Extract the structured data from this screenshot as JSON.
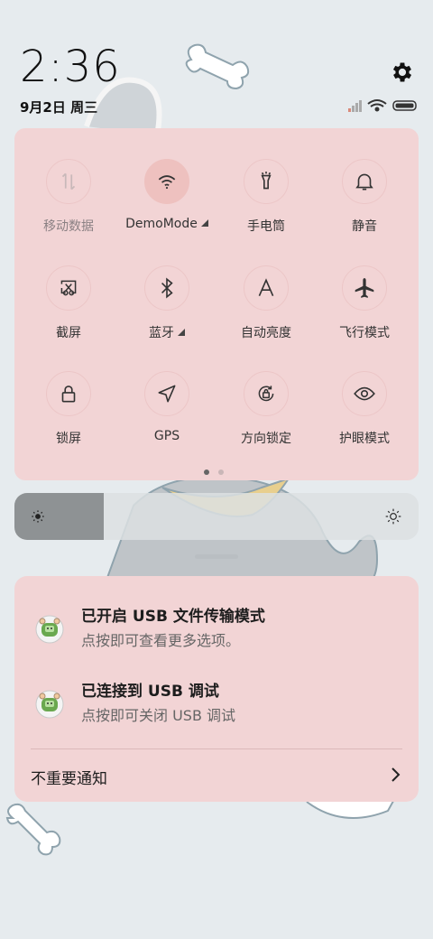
{
  "status_bar": {
    "time": "2:36",
    "date": "9月2日 周三",
    "settings_icon": "gear-icon",
    "signal_icon": "signal-icon",
    "wifi_icon": "wifi-icon",
    "battery_icon": "battery-icon"
  },
  "quick_settings": {
    "tiles": [
      {
        "label": "移动数据",
        "icon": "mobile-data-icon",
        "active": false,
        "disabled": true
      },
      {
        "label": "DemoMode",
        "icon": "wifi-icon",
        "active": true,
        "expandable": true
      },
      {
        "label": "手电筒",
        "icon": "flashlight-icon",
        "active": false
      },
      {
        "label": "静音",
        "icon": "bell-icon",
        "active": false
      },
      {
        "label": "截屏",
        "icon": "screenshot-icon",
        "active": false
      },
      {
        "label": "蓝牙",
        "icon": "bluetooth-icon",
        "active": false,
        "expandable": true
      },
      {
        "label": "自动亮度",
        "icon": "auto-brightness-icon",
        "active": false
      },
      {
        "label": "飞行模式",
        "icon": "airplane-icon",
        "active": false
      },
      {
        "label": "锁屏",
        "icon": "lock-icon",
        "active": false
      },
      {
        "label": "GPS",
        "icon": "location-icon",
        "active": false
      },
      {
        "label": "方向锁定",
        "icon": "rotation-lock-icon",
        "active": false
      },
      {
        "label": "护眼模式",
        "icon": "eye-icon",
        "active": false
      }
    ],
    "page_count": 2,
    "current_page": 1
  },
  "brightness": {
    "level_fraction": 0.22
  },
  "notifications": {
    "items": [
      {
        "title": "已开启 USB 文件传输模式",
        "subtitle": "点按即可查看更多选项。",
        "icon": "android-icon"
      },
      {
        "title": "已连接到 USB 调试",
        "subtitle": "点按即可关闭 USB 调试",
        "icon": "android-icon"
      }
    ],
    "unimportant_label": "不重要通知"
  },
  "colors": {
    "panel": "#f2d4d5",
    "background": "#e6ebee",
    "active_tile": "#eec1bf"
  }
}
